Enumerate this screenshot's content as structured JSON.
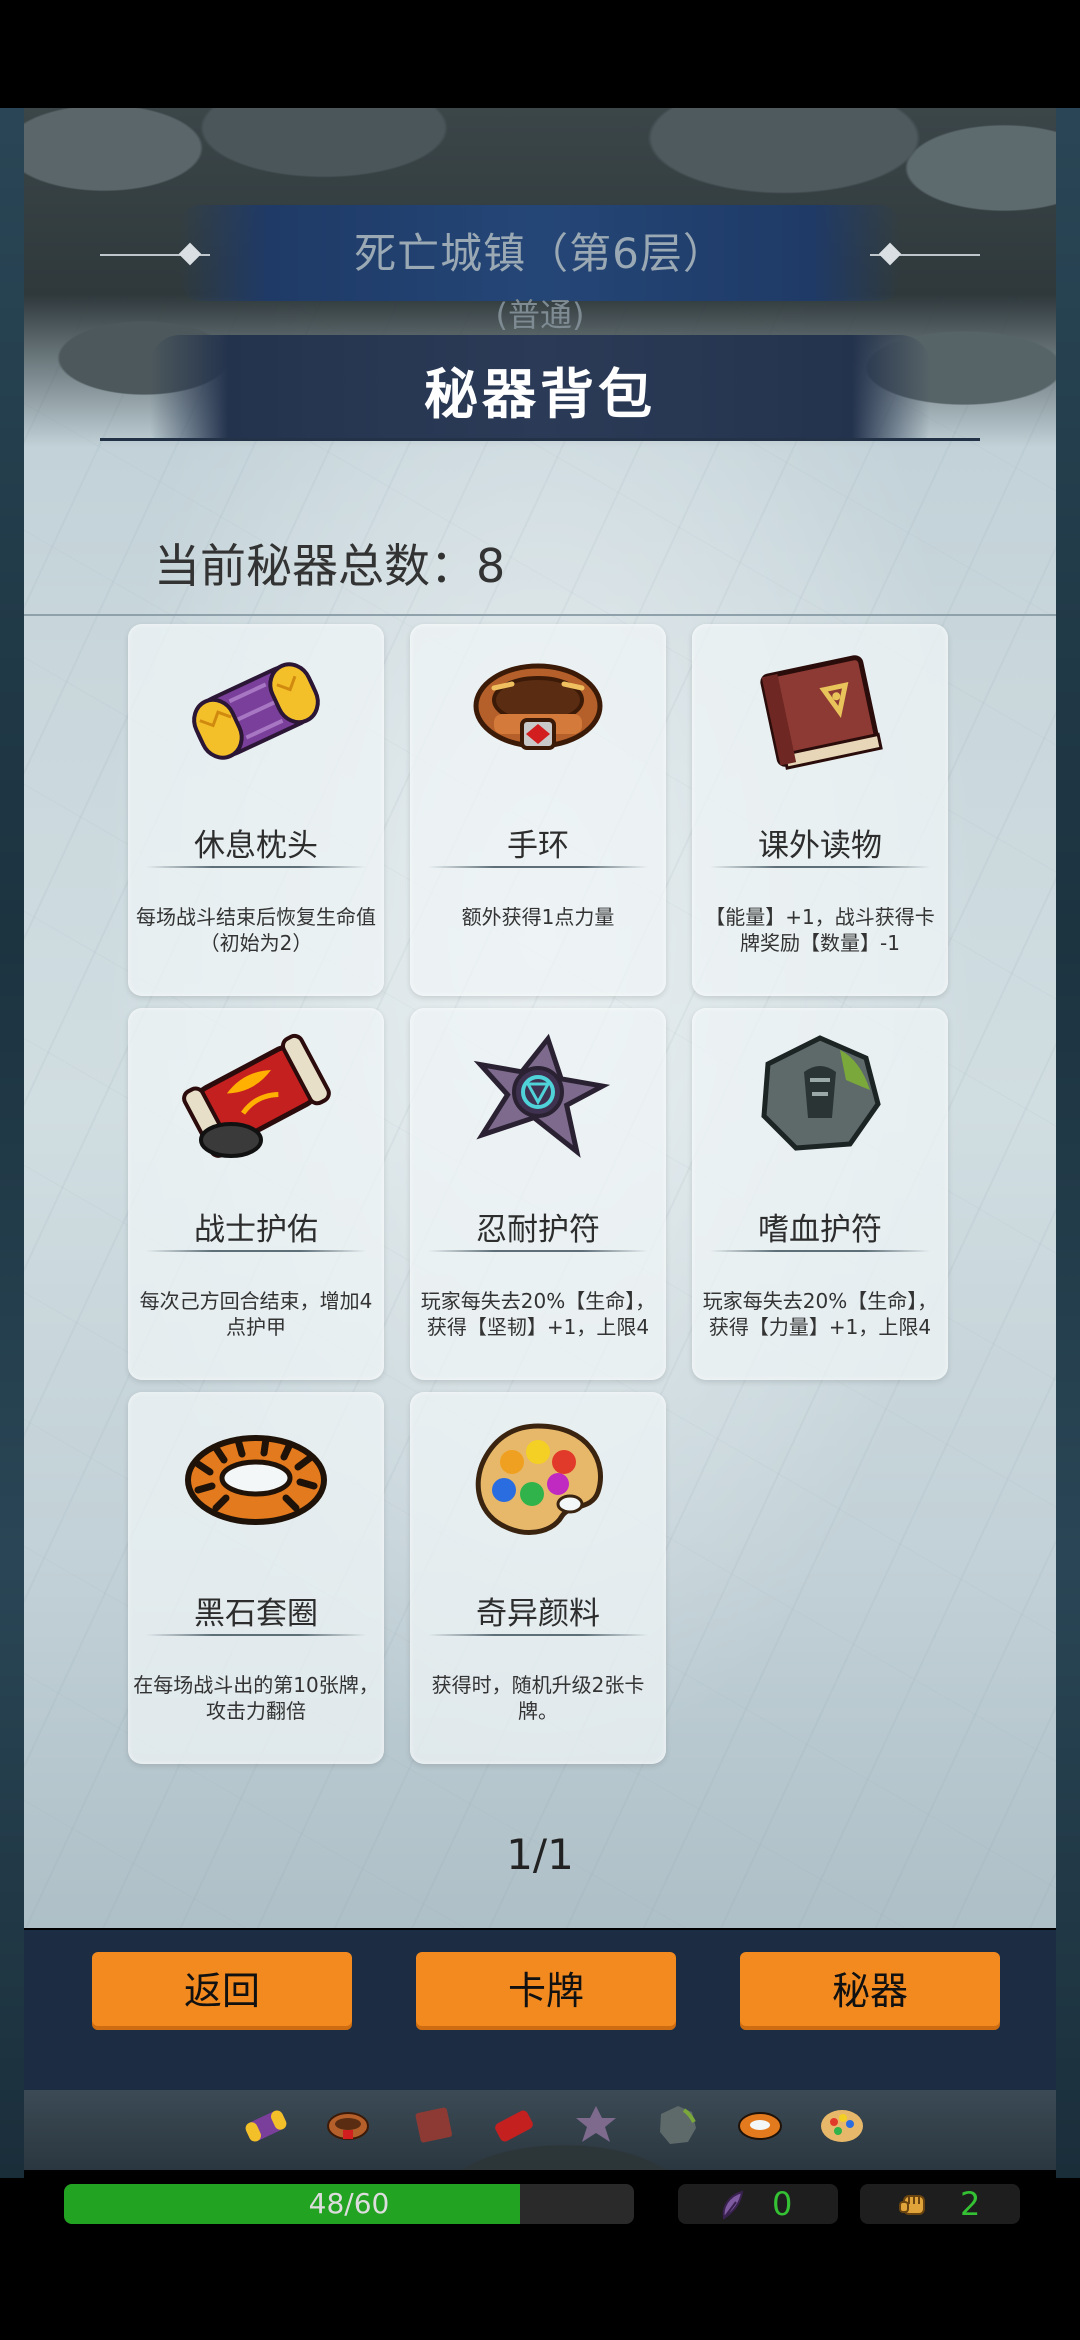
{
  "header": {
    "location_title": "死亡城镇（第6层）",
    "difficulty": "(普通)",
    "screen_title": "秘器背包"
  },
  "summary": {
    "count_label": "当前秘器总数：",
    "count_value": "8"
  },
  "relics": [
    {
      "icon": "pillow-icon",
      "name": "休息枕头",
      "desc": "每场战斗结束后恢复生命值（初始为2）"
    },
    {
      "icon": "bracelet-icon",
      "name": "手环",
      "desc": "额外获得1点力量"
    },
    {
      "icon": "book-icon",
      "name": "课外读物",
      "desc": "【能量】+1，战斗获得卡牌奖励【数量】-1"
    },
    {
      "icon": "scroll-icon",
      "name": "战士护佑",
      "desc": "每次己方回合结束，增加4点护甲"
    },
    {
      "icon": "shuriken-amulet-icon",
      "name": "忍耐护符",
      "desc": "玩家每失去20%【生命】，获得【坚韧】+1，上限4"
    },
    {
      "icon": "stone-amulet-icon",
      "name": "嗜血护符",
      "desc": "玩家每失去20%【生命】，获得【力量】+1，上限4"
    },
    {
      "icon": "ring-icon",
      "name": "黑石套圈",
      "desc": "在每场战斗出的第10张牌，攻击力翻倍"
    },
    {
      "icon": "palette-icon",
      "name": "奇异颜料",
      "desc": "获得时，随机升级2张卡牌。"
    }
  ],
  "pagination": {
    "text": "1/1"
  },
  "buttons": {
    "back": "返回",
    "cards": "卡牌",
    "relics": "秘器"
  },
  "status": {
    "hp_text": "48/60",
    "hp_fraction": 0.8,
    "energy_value": "0",
    "power_value": "2"
  },
  "colors": {
    "accent_button": "#f28a20",
    "hp_bar": "#22a322",
    "stat_value": "#34c234"
  }
}
